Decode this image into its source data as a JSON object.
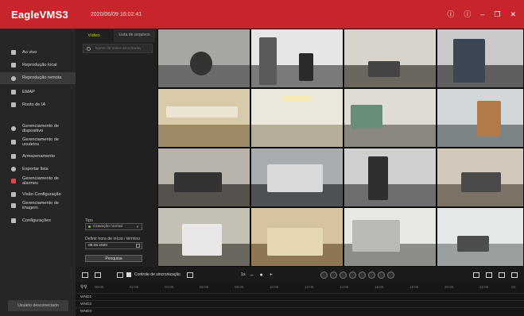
{
  "app": {
    "logo": "EagleVMS3",
    "datetime": "2020/06/09 16:02:41"
  },
  "window_controls": [
    {
      "name": "info-icon",
      "glyph": "ⓘ"
    },
    {
      "name": "help-icon",
      "glyph": "?"
    },
    {
      "name": "minimize-icon",
      "glyph": "–"
    },
    {
      "name": "restore-icon",
      "glyph": "❐"
    },
    {
      "name": "close-icon",
      "glyph": "✕"
    }
  ],
  "sidebar": {
    "items": [
      {
        "label": "Ao vivo",
        "icon": "monitor-icon"
      },
      {
        "label": "Reprodução local",
        "icon": "playback-icon"
      },
      {
        "label": "Reprodução remota",
        "icon": "remote-playback-icon",
        "active": true
      },
      {
        "label": "EMAP",
        "icon": "map-icon"
      },
      {
        "label": "Rosto de IA",
        "icon": "face-icon"
      },
      {
        "label": "Gerenciamento de dispositivo",
        "icon": "device-icon"
      },
      {
        "label": "Gerenciamento de usuários",
        "icon": "user-icon"
      },
      {
        "label": "Armazenamento",
        "icon": "storage-icon"
      },
      {
        "label": "Exportar lista",
        "icon": "export-icon"
      },
      {
        "label": "Gerenciamento de alarmes",
        "icon": "alarm-icon"
      },
      {
        "label": "Visão Configuração",
        "icon": "view-config-icon"
      },
      {
        "label": "Gerenciamento de imagem",
        "icon": "image-icon"
      },
      {
        "label": "Configurações",
        "icon": "settings-icon"
      }
    ],
    "user_button": "Usuário desconectado"
  },
  "panel": {
    "tab_video": "Vídeo",
    "tab_files": "Lista de arquivos",
    "search_placeholder": "Nome do vídeo de entrada",
    "type_label": "Tipo",
    "type_value": "Gravação normal",
    "time_label": "Definir hora de início / término",
    "date_value": "09.06.2020",
    "search_button": "Pesquisa"
  },
  "toolbar": {
    "sync_label": "Controle de sincronização",
    "speed": "1x"
  },
  "timeline": {
    "ticks": [
      "00:00",
      "02:00",
      "04:00",
      "06:00",
      "08:00",
      "10:00",
      "12:00",
      "14:00",
      "16:00",
      "18:00",
      "20:00",
      "22:00",
      "00:"
    ],
    "rows": [
      "WND1",
      "WND2",
      "WND3"
    ]
  },
  "colors": {
    "title_bar": "#c6252b",
    "active_tab": "#c7d100"
  }
}
